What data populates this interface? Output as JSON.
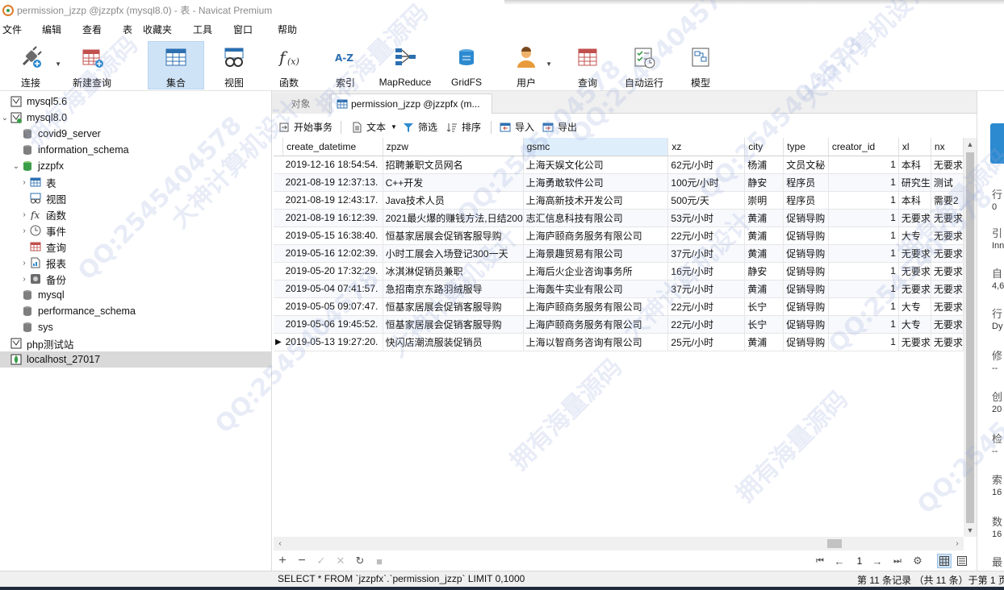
{
  "window": {
    "title": "permission_jzzp @jzzpfx (mysql8.0) - 表 - Navicat Premium"
  },
  "menu": [
    "文件",
    "编辑",
    "查看",
    "表",
    "收藏夹",
    "工具",
    "窗口",
    "帮助"
  ],
  "toolbar": {
    "items": [
      {
        "label": "连接",
        "icon": "plug-icon"
      },
      {
        "label": "新建查询",
        "icon": "new-query-icon"
      },
      {
        "label": "集合",
        "icon": "table-grid-icon",
        "active": true
      },
      {
        "label": "视图",
        "icon": "glasses-icon"
      },
      {
        "label": "函数",
        "icon": "function-icon"
      },
      {
        "label": "索引",
        "icon": "az-icon"
      },
      {
        "label": "MapReduce",
        "icon": "mapreduce-icon"
      },
      {
        "label": "GridFS",
        "icon": "gridfs-icon"
      },
      {
        "label": "用户",
        "icon": "user-icon"
      },
      {
        "label": "查询",
        "icon": "query-icon"
      },
      {
        "label": "自动运行",
        "icon": "checklist-icon"
      },
      {
        "label": "模型",
        "icon": "model-icon"
      }
    ]
  },
  "sidebar": {
    "items": [
      {
        "label": "mysql5.6",
        "icon": "connection-icon",
        "level": 0,
        "expander": ""
      },
      {
        "label": "mysql8.0",
        "icon": "connection-active-icon",
        "level": 0,
        "expander": "⌄"
      },
      {
        "label": "covid9_server",
        "icon": "database-icon",
        "level": 1,
        "expander": ""
      },
      {
        "label": "information_schema",
        "icon": "database-icon",
        "level": 1,
        "expander": ""
      },
      {
        "label": "jzzpfx",
        "icon": "database-active-icon",
        "level": 1,
        "expander": "⌄"
      },
      {
        "label": "表",
        "icon": "table-icon",
        "level": 2,
        "expander": "›"
      },
      {
        "label": "视图",
        "icon": "view-icon",
        "level": 2,
        "expander": ""
      },
      {
        "label": "函数",
        "icon": "function-icon",
        "level": 2,
        "expander": "›"
      },
      {
        "label": "事件",
        "icon": "clock-icon",
        "level": 2,
        "expander": "›"
      },
      {
        "label": "查询",
        "icon": "query-icon",
        "level": 2,
        "expander": ""
      },
      {
        "label": "报表",
        "icon": "report-icon",
        "level": 2,
        "expander": "›"
      },
      {
        "label": "备份",
        "icon": "backup-icon",
        "level": 2,
        "expander": "›"
      },
      {
        "label": "mysql",
        "icon": "database-icon",
        "level": 1,
        "expander": ""
      },
      {
        "label": "performance_schema",
        "icon": "database-icon",
        "level": 1,
        "expander": ""
      },
      {
        "label": "sys",
        "icon": "database-icon",
        "level": 1,
        "expander": ""
      },
      {
        "label": "php测试站",
        "icon": "connection-icon",
        "level": 0,
        "expander": ""
      },
      {
        "label": "localhost_27017",
        "icon": "mongodb-icon",
        "level": 0,
        "expander": "",
        "selected": true
      }
    ]
  },
  "tabs": {
    "objects": "对象",
    "table": "permission_jzzp @jzzpfx (m..."
  },
  "grid_toolbar": {
    "begin_transaction": "开始事务",
    "text": "文本",
    "filter": "筛选",
    "sort": "排序",
    "import": "导入",
    "export": "导出"
  },
  "grid": {
    "columns": [
      "create_datetime",
      "zpzw",
      "gsmc",
      "xz",
      "city",
      "type",
      "creator_id",
      "xl",
      "nx"
    ],
    "highlighted_column": "gsmc",
    "rows": [
      [
        "2019-12-16 18:54:54.",
        "招聘兼职文员网名",
        "上海天娱文化公司",
        "62元/小时",
        "杨浦",
        "文员文秘",
        "1",
        "本科",
        "无要求"
      ],
      [
        "2021-08-19 12:37:13.",
        "C++开发",
        "上海勇敢软件公司",
        "100元/小时",
        "静安",
        "程序员",
        "1",
        "研究生",
        "测试"
      ],
      [
        "2021-08-19 12:43:17.",
        "Java技术人员",
        "上海高新技术开发公司",
        "500元/天",
        "崇明",
        "程序员",
        "1",
        "本科",
        "需要2"
      ],
      [
        "2021-08-19 16:12:39.",
        "2021最火爆的赚钱方法,日结200",
        "志汇信息科技有限公司",
        "53元/小时",
        "黄浦",
        "促销导购",
        "1",
        "无要求",
        "无要求"
      ],
      [
        "2019-05-15 16:38:40.",
        "恒基家居展会促销客服导购",
        "上海庐颐商务服务有限公司",
        "22元/小时",
        "黄浦",
        "促销导购",
        "1",
        "大专",
        "无要求"
      ],
      [
        "2019-05-16 12:02:39.",
        "小时工展会入场登记300一天",
        "上海景趣贸易有限公司",
        "37元/小时",
        "黄浦",
        "促销导购",
        "1",
        "无要求",
        "无要求"
      ],
      [
        "2019-05-20 17:32:29.",
        "冰淇淋促销员兼职",
        "上海后火企业咨询事务所",
        "16元/小时",
        "静安",
        "促销导购",
        "1",
        "无要求",
        "无要求"
      ],
      [
        "2019-05-04 07:41:57.",
        "急招南京东路羽绒服导",
        "上海轰牛实业有限公司",
        "37元/小时",
        "黄浦",
        "促销导购",
        "1",
        "无要求",
        "无要求"
      ],
      [
        "2019-05-05 09:07:47.",
        "恒基家居展会促销客服导购",
        "上海庐颐商务服务有限公司",
        "22元/小时",
        "长宁",
        "促销导购",
        "1",
        "大专",
        "无要求"
      ],
      [
        "2019-05-06 19:45:52.",
        "恒基家居展会促销客服导购",
        "上海庐颐商务服务有限公司",
        "22元/小时",
        "长宁",
        "促销导购",
        "1",
        "大专",
        "无要求"
      ],
      [
        "2019-05-13 19:27:20.",
        "快闪店潮流服装促销员",
        "上海以智商务咨询有限公司",
        "25元/小时",
        "黄浦",
        "促销导购",
        "1",
        "无要求",
        "无要求"
      ]
    ],
    "current_row_marker": "▶"
  },
  "record_nav": {
    "page": "1"
  },
  "status": {
    "sql": "SELECT * FROM `jzzpfx`.`permission_jzzp` LIMIT 0,1000",
    "count": "第 11 条记录 （共 11 条）于第 1 页"
  },
  "info_panel": {
    "labels": [
      "行",
      "0",
      "引",
      "Inn",
      "自",
      "4,6",
      "行",
      "Dy",
      "修",
      "--",
      "创",
      "20",
      "检",
      "--",
      "索",
      "16",
      "数",
      "16",
      "最"
    ]
  },
  "watermarks": [
    "拥有海量源码",
    "QQ:2545404578",
    "大神计算机设计",
    "QQ:2545404578",
    "拥有海量源码",
    "大神计算机设计",
    "QQ:2545404578",
    "拥有海量源码",
    "QQ:2545404578",
    "大神计算机设计",
    "QQ:2545404578",
    "拥有海量源码",
    "大神计算机设计",
    "QQ:2545404578",
    "拥有海量源码",
    "QQ:2545404578"
  ],
  "colors": {
    "accent": "#2c8ad0",
    "active_tool": "#cfe3f7",
    "highlight_header": "#dfeefb",
    "selected_row": "#d9d9d9",
    "watermark": "#96aadc"
  }
}
